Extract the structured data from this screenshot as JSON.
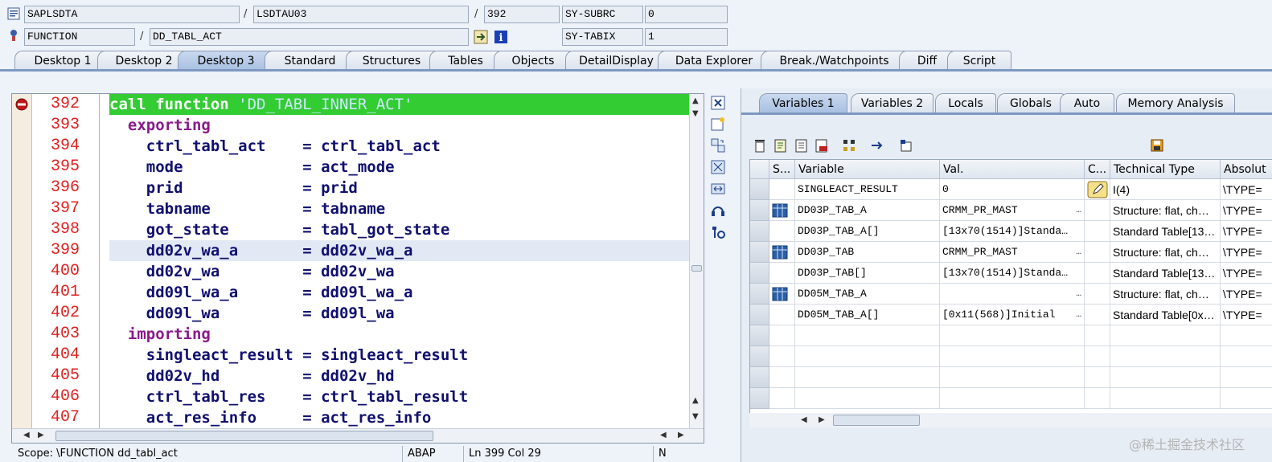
{
  "header": {
    "row1": {
      "program": "SAPLSDTA",
      "sep1": "/",
      "include": "LSDTAU03",
      "sep2": "/",
      "line": "392",
      "sysfield": "SY-SUBRC",
      "sysvalue": "0"
    },
    "row2": {
      "type": "FUNCTION",
      "sep": "/",
      "name": "DD_TABL_ACT",
      "sysfield": "SY-TABIX",
      "sysvalue": "1"
    }
  },
  "tabs": [
    {
      "label": "Desktop 1",
      "active": false
    },
    {
      "label": "Desktop 2",
      "active": false
    },
    {
      "label": "Desktop 3",
      "active": true
    },
    {
      "label": "Standard",
      "active": false
    },
    {
      "label": "Structures",
      "active": false
    },
    {
      "label": "Tables",
      "active": false
    },
    {
      "label": "Objects",
      "active": false
    },
    {
      "label": "DetailDisplay",
      "active": false
    },
    {
      "label": "Data Explorer",
      "active": false
    },
    {
      "label": "Break./Watchpoints",
      "active": false
    },
    {
      "label": "Diff",
      "active": false
    },
    {
      "label": "Script",
      "active": false
    }
  ],
  "code": {
    "lines": [
      {
        "num": "392",
        "pre": "call function ",
        "kw": "",
        "text": "",
        "str": "'DD_TABL_INNER_ACT'",
        "style": "current"
      },
      {
        "num": "393",
        "pre": "  ",
        "kw": "exporting",
        "text": "",
        "str": "",
        "style": ""
      },
      {
        "num": "394",
        "pre": "    ",
        "kw": "",
        "text": "ctrl_tabl_act    = ctrl_tabl_act",
        "str": "",
        "style": ""
      },
      {
        "num": "395",
        "pre": "    ",
        "kw": "",
        "text": "mode             = act_mode",
        "str": "",
        "style": ""
      },
      {
        "num": "396",
        "pre": "    ",
        "kw": "",
        "text": "prid             = prid",
        "str": "",
        "style": ""
      },
      {
        "num": "397",
        "pre": "    ",
        "kw": "",
        "text": "tabname          = tabname",
        "str": "",
        "style": ""
      },
      {
        "num": "398",
        "pre": "    ",
        "kw": "",
        "text": "got_state        = tabl_got_state",
        "str": "",
        "style": ""
      },
      {
        "num": "399",
        "pre": "    ",
        "kw": "",
        "text": "dd02v_wa_a       = dd02v_wa_a",
        "str": "",
        "style": "cursor"
      },
      {
        "num": "400",
        "pre": "    ",
        "kw": "",
        "text": "dd02v_wa         = dd02v_wa",
        "str": "",
        "style": ""
      },
      {
        "num": "401",
        "pre": "    ",
        "kw": "",
        "text": "dd09l_wa_a       = dd09l_wa_a",
        "str": "",
        "style": ""
      },
      {
        "num": "402",
        "pre": "    ",
        "kw": "",
        "text": "dd09l_wa         = dd09l_wa",
        "str": "",
        "style": ""
      },
      {
        "num": "403",
        "pre": "  ",
        "kw": "importing",
        "text": "",
        "str": "",
        "style": ""
      },
      {
        "num": "404",
        "pre": "    ",
        "kw": "",
        "text": "singleact_result = singleact_result",
        "str": "",
        "style": ""
      },
      {
        "num": "405",
        "pre": "    ",
        "kw": "",
        "text": "dd02v_hd         = dd02v_hd",
        "str": "",
        "style": ""
      },
      {
        "num": "406",
        "pre": "    ",
        "kw": "",
        "text": "ctrl_tabl_res    = ctrl_tabl_result",
        "str": "",
        "style": ""
      },
      {
        "num": "407",
        "pre": "    ",
        "kw": "",
        "text": "act_res_info     = act_res_info",
        "str": "",
        "style": ""
      }
    ]
  },
  "status": {
    "scope": "Scope: \\FUNCTION dd_tabl_act",
    "lang": "ABAP",
    "pos": "Ln 399 Col 29",
    "mode": "N"
  },
  "right_tabs": [
    {
      "label": "Variables 1",
      "active": true
    },
    {
      "label": "Variables 2",
      "active": false
    },
    {
      "label": "Locals",
      "active": false
    },
    {
      "label": "Globals",
      "active": false
    },
    {
      "label": "Auto",
      "active": false
    },
    {
      "label": "Memory Analysis",
      "active": false
    }
  ],
  "grid": {
    "headers": {
      "s": "S...",
      "variable": "Variable",
      "val": "Val.",
      "c": "C...",
      "tech": "Technical Type",
      "abs": "Absolut"
    },
    "rows": [
      {
        "icon": "",
        "variable": "SINGLEACT_RESULT",
        "val": "0",
        "more": "",
        "edit": true,
        "tech": "I(4)",
        "abs": "\\TYPE="
      },
      {
        "icon": "structure-icon",
        "variable": "DD03P_TAB_A",
        "val": "CRMM_PR_MAST",
        "more": "…",
        "edit": false,
        "tech": "Structure: flat, ch…",
        "abs": "\\TYPE="
      },
      {
        "icon": "",
        "variable": "DD03P_TAB_A[]",
        "val": "[13x70(1514)]Standa…",
        "more": "",
        "edit": false,
        "tech": "Standard Table[13…",
        "abs": "\\TYPE="
      },
      {
        "icon": "structure-icon",
        "variable": "DD03P_TAB",
        "val": "CRMM_PR_MAST",
        "more": "…",
        "edit": false,
        "tech": "Structure: flat, ch…",
        "abs": "\\TYPE="
      },
      {
        "icon": "",
        "variable": "DD03P_TAB[]",
        "val": "[13x70(1514)]Standa…",
        "more": "",
        "edit": false,
        "tech": "Standard Table[13…",
        "abs": "\\TYPE="
      },
      {
        "icon": "structure-icon",
        "variable": "DD05M_TAB_A",
        "val": "",
        "more": "…",
        "edit": false,
        "tech": "Structure: flat, ch…",
        "abs": "\\TYPE="
      },
      {
        "icon": "",
        "variable": "DD05M_TAB_A[]",
        "val": "[0x11(568)]Initial",
        "more": "…",
        "edit": false,
        "tech": "Standard Table[0x…",
        "abs": "\\TYPE="
      },
      {
        "icon": "",
        "variable": "",
        "val": "",
        "more": "",
        "edit": false,
        "tech": "",
        "abs": ""
      },
      {
        "icon": "",
        "variable": "",
        "val": "",
        "more": "",
        "edit": false,
        "tech": "",
        "abs": ""
      },
      {
        "icon": "",
        "variable": "",
        "val": "",
        "more": "",
        "edit": false,
        "tech": "",
        "abs": ""
      },
      {
        "icon": "",
        "variable": "",
        "val": "",
        "more": "",
        "edit": false,
        "tech": "",
        "abs": ""
      }
    ]
  },
  "watermark": "@稀土掘金技术社区",
  "colors": {
    "accent": "#7e98c2",
    "current_line": "#33cc33",
    "line_numbers": "#e02020",
    "keyword": "#8a1a8a",
    "identifier": "#101070"
  }
}
